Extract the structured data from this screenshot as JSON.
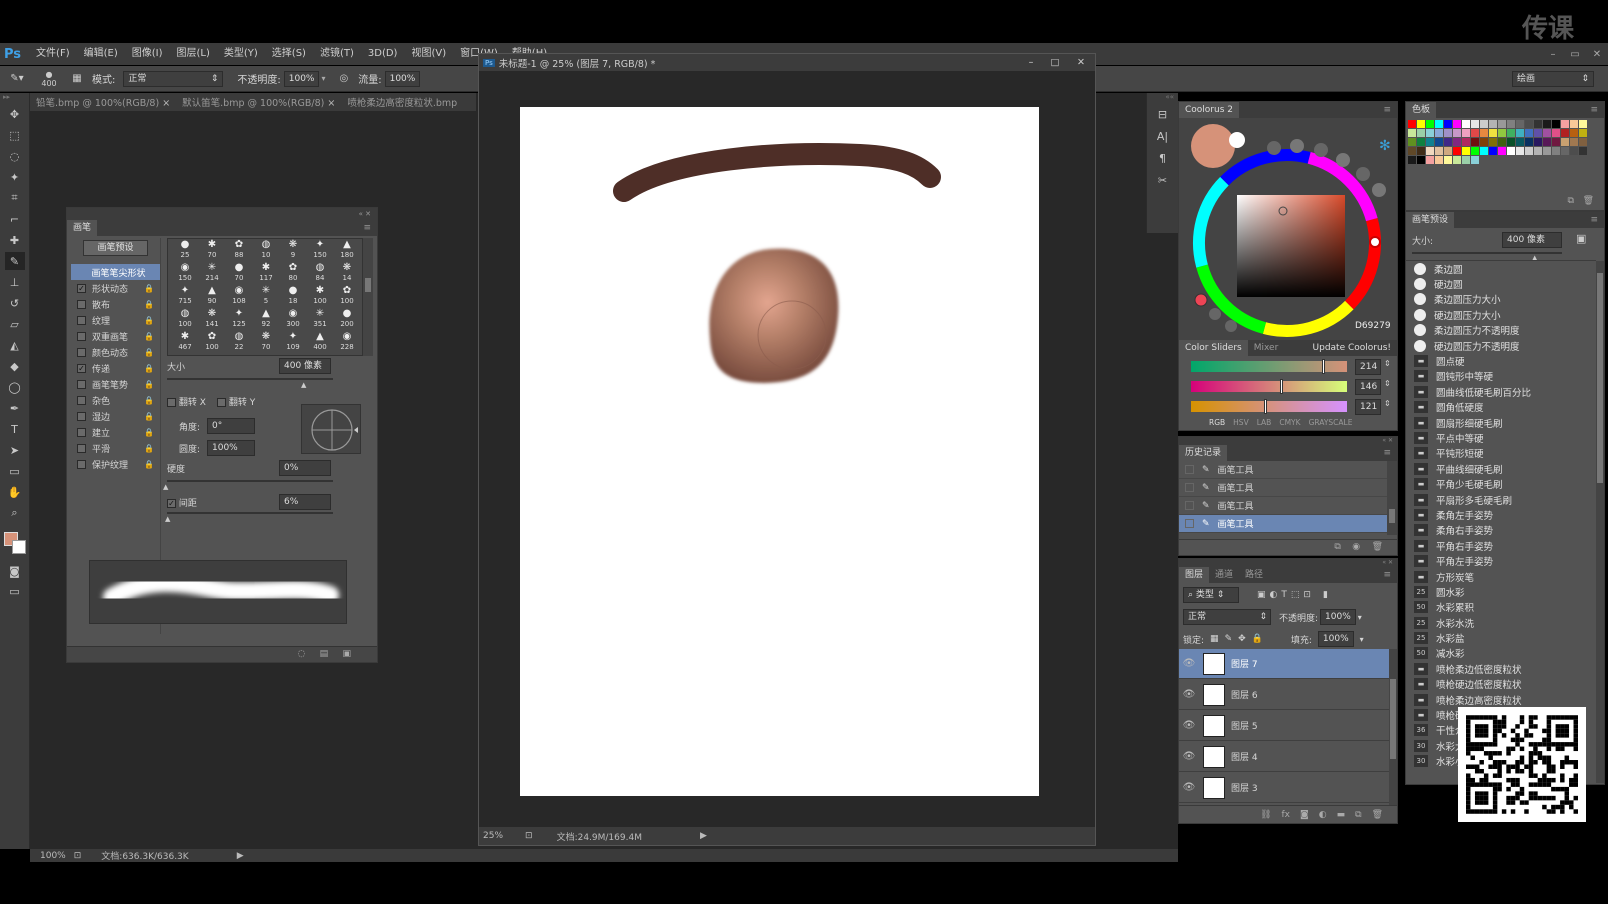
{
  "watermark": "传课",
  "app": {
    "logo": "Ps"
  },
  "menu": [
    "文件(F)",
    "编辑(E)",
    "图像(I)",
    "图层(L)",
    "类型(Y)",
    "选择(S)",
    "滤镜(T)",
    "3D(D)",
    "视图(V)",
    "窗口(W)",
    "帮助(H)"
  ],
  "options_bar": {
    "brush_size": "400",
    "mode_label": "模式:",
    "mode_value": "正常",
    "opacity_label": "不透明度:",
    "opacity_value": "100%",
    "flow_label": "流量:",
    "flow_value": "100%",
    "workspace": "绘画"
  },
  "doc_tabs": [
    "铅笔.bmp @ 100%(RGB/8)",
    "默认笛笔.bmp @ 100%(RGB/8)",
    "喷枪柔边高密度粒状.bmp"
  ],
  "doc_window": {
    "title": "未标题-1 @ 25% (图层 7, RGB/8) *",
    "zoom": "25%",
    "doc_info": "文档:24.9M/169.4M"
  },
  "status_bar": {
    "zoom": "100%",
    "doc_info": "文档:636.3K/636.3K"
  },
  "brush_panel": {
    "tab": "画笔",
    "preset_button": "画笔预设",
    "categories": [
      {
        "label": "画笔笔尖形状",
        "checked": null,
        "selected": true
      },
      {
        "label": "形状动态",
        "checked": true
      },
      {
        "label": "散布",
        "checked": false
      },
      {
        "label": "纹理",
        "checked": false
      },
      {
        "label": "双重画笔",
        "checked": false
      },
      {
        "label": "颜色动态",
        "checked": false
      },
      {
        "label": "传递",
        "checked": true
      },
      {
        "label": "画笔笔势",
        "checked": false
      },
      {
        "label": "杂色",
        "checked": false
      },
      {
        "label": "湿边",
        "checked": false
      },
      {
        "label": "建立",
        "checked": false
      },
      {
        "label": "平滑",
        "checked": false
      },
      {
        "label": "保护纹理",
        "checked": false
      }
    ],
    "tip_sizes": [
      [
        "25",
        "70",
        "88",
        "10",
        "9",
        "150",
        "180"
      ],
      [
        "150",
        "214",
        "70",
        "117",
        "80",
        "84",
        "14"
      ],
      [
        "715",
        "90",
        "108",
        "5",
        "18",
        "100",
        "100"
      ],
      [
        "100",
        "141",
        "125",
        "92",
        "300",
        "351",
        "200"
      ],
      [
        "467",
        "100",
        "22",
        "70",
        "109",
        "400",
        "228"
      ]
    ],
    "size_label": "大小",
    "size_value": "400 像素",
    "flip_x": "翻转 X",
    "flip_y": "翻转 Y",
    "angle_label": "角度:",
    "angle_value": "0°",
    "roundness_label": "圆度:",
    "roundness_value": "100%",
    "hardness_label": "硬度",
    "hardness_value": "0%",
    "spacing_label": "间距",
    "spacing_value": "6%"
  },
  "coolorus": {
    "title": "Coolorus 2",
    "hex": "D69279",
    "tabs": [
      "Color Sliders",
      "Mixer",
      "Update Coolorus!"
    ],
    "sliders": [
      {
        "value": "214",
        "fraction": 0.84
      },
      {
        "value": "146",
        "fraction": 0.57
      },
      {
        "value": "121",
        "fraction": 0.47
      }
    ],
    "modes": [
      "RGB",
      "HSV",
      "LAB",
      "CMYK",
      "GRAYSCALE"
    ],
    "fg_color": "#d69279"
  },
  "history": {
    "title": "历史记录",
    "items": [
      "画笔工具",
      "画笔工具",
      "画笔工具",
      "画笔工具"
    ]
  },
  "layers": {
    "tabs": [
      "图层",
      "通道",
      "路径"
    ],
    "kind_filter": "类型",
    "blend_mode": "正常",
    "opacity_label": "不透明度:",
    "opacity_value": "100%",
    "lock_label": "锁定:",
    "fill_label": "填充:",
    "fill_value": "100%",
    "items": [
      "图层 7",
      "图层 6",
      "图层 5",
      "图层 4",
      "图层 3"
    ]
  },
  "swatches": {
    "title": "色板"
  },
  "brush_presets": {
    "title": "画笔预设",
    "size_label": "大小:",
    "size_value": "400 像素",
    "items": [
      {
        "name": "柔边圆",
        "num": ""
      },
      {
        "name": "硬边圆",
        "num": ""
      },
      {
        "name": "柔边圆压力大小",
        "num": ""
      },
      {
        "name": "硬边圆压力大小",
        "num": ""
      },
      {
        "name": "柔边圆压力不透明度",
        "num": ""
      },
      {
        "name": "硬边圆压力不透明度",
        "num": ""
      },
      {
        "name": "圆点硬",
        "num": ""
      },
      {
        "name": "圆钝形中等硬",
        "num": ""
      },
      {
        "name": "圆曲线低硬毛刷百分比",
        "num": ""
      },
      {
        "name": "圆角低硬度",
        "num": ""
      },
      {
        "name": "圆扇形细硬毛刷",
        "num": ""
      },
      {
        "name": "平点中等硬",
        "num": ""
      },
      {
        "name": "平钝形短硬",
        "num": ""
      },
      {
        "name": "平曲线细硬毛刷",
        "num": ""
      },
      {
        "name": "平角少毛硬毛刷",
        "num": ""
      },
      {
        "name": "平扇形多毛硬毛刷",
        "num": ""
      },
      {
        "name": "柔角左手姿势",
        "num": ""
      },
      {
        "name": "柔角右手姿势",
        "num": ""
      },
      {
        "name": "平角右手姿势",
        "num": ""
      },
      {
        "name": "平角左手姿势",
        "num": ""
      },
      {
        "name": "方形炭笔",
        "num": ""
      },
      {
        "name": "圆水彩",
        "num": "25"
      },
      {
        "name": "水彩累积",
        "num": "50"
      },
      {
        "name": "水彩水洗",
        "num": "25"
      },
      {
        "name": "水彩盐",
        "num": "25"
      },
      {
        "name": "减水彩",
        "num": "50"
      },
      {
        "name": "喷枪柔边低密度粒状",
        "num": ""
      },
      {
        "name": "喷枪硬边低密度粒状",
        "num": ""
      },
      {
        "name": "喷枪柔边高密度粒状",
        "num": ""
      },
      {
        "name": "喷枪硬边高密度粒状",
        "num": ""
      },
      {
        "name": "干性介质画笔",
        "num": "36"
      },
      {
        "name": "水彩大溅滴",
        "num": "30"
      },
      {
        "name": "水彩小溅滴",
        "num": "30"
      }
    ]
  }
}
